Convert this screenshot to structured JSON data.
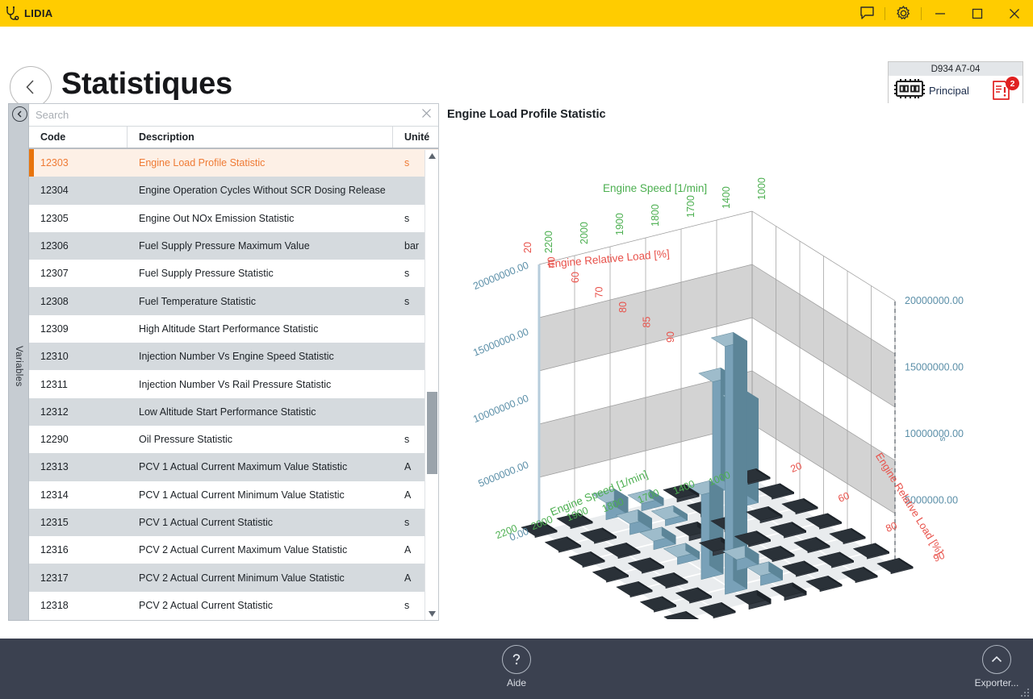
{
  "titlebar": {
    "app_name": "LIDIA",
    "logo_icon": "stethoscope-icon",
    "chat_icon": "chat-bubble-icon",
    "settings_icon": "gear-icon",
    "minimize_icon": "minimize-icon",
    "maximize_icon": "maximize-icon",
    "close_icon": "close-icon",
    "background": "#FFCC00"
  },
  "header": {
    "back_icon": "chevron-left-icon",
    "title": "Statistiques",
    "device": {
      "model": "D934 A7-04",
      "name": "Principal",
      "ecu_icon": "ecu-chip-icon",
      "warning_icon": "warning-document-icon",
      "warning_count": "2",
      "warning_color": "#e02020"
    }
  },
  "sidebar": {
    "tab_label": "Variables",
    "collapse_icon": "chevron-left-circle-icon"
  },
  "search": {
    "placeholder": "Search",
    "value": "",
    "clear_icon": "close-icon"
  },
  "table": {
    "columns": [
      "Code",
      "Description",
      "Unité"
    ],
    "selected_code": "12303",
    "selection_color": "#e8740c",
    "rows": [
      {
        "code": "12303",
        "description": "Engine Load Profile Statistic",
        "unit": "s"
      },
      {
        "code": "12304",
        "description": "Engine Operation Cycles Without SCR Dosing Release",
        "unit": ""
      },
      {
        "code": "12305",
        "description": "Engine Out NOx Emission Statistic",
        "unit": "s"
      },
      {
        "code": "12306",
        "description": "Fuel Supply Pressure Maximum Value",
        "unit": "bar"
      },
      {
        "code": "12307",
        "description": "Fuel Supply Pressure Statistic",
        "unit": "s"
      },
      {
        "code": "12308",
        "description": "Fuel Temperature Statistic",
        "unit": "s"
      },
      {
        "code": "12309",
        "description": "High Altitude Start Performance Statistic",
        "unit": ""
      },
      {
        "code": "12310",
        "description": "Injection Number Vs Engine Speed Statistic",
        "unit": ""
      },
      {
        "code": "12311",
        "description": "Injection Number Vs Rail Pressure Statistic",
        "unit": ""
      },
      {
        "code": "12312",
        "description": "Low Altitude Start Performance Statistic",
        "unit": ""
      },
      {
        "code": "12290",
        "description": "Oil Pressure Statistic",
        "unit": "s"
      },
      {
        "code": "12313",
        "description": "PCV 1 Actual Current Maximum Value Statistic",
        "unit": "A"
      },
      {
        "code": "12314",
        "description": "PCV 1 Actual Current Minimum Value Statistic",
        "unit": "A"
      },
      {
        "code": "12315",
        "description": "PCV 1 Actual Current Statistic",
        "unit": "s"
      },
      {
        "code": "12316",
        "description": "PCV 2 Actual Current Maximum Value Statistic",
        "unit": "A"
      },
      {
        "code": "12317",
        "description": "PCV 2 Actual Current Minimum Value Statistic",
        "unit": "A"
      },
      {
        "code": "12318",
        "description": "PCV 2 Actual Current Statistic",
        "unit": "s"
      }
    ],
    "scroll_up_icon": "triangle-up-icon",
    "scroll_down_icon": "triangle-down-icon"
  },
  "chart_panel": {
    "title": "Engine Load Profile Statistic"
  },
  "chart_data": {
    "type": "bar",
    "title": "Engine Load Profile Statistic",
    "render": "3d-bar",
    "xlabel": "Engine Speed [1/min]",
    "ylabel": "Engine Relative Load [%]",
    "zlabel": "s",
    "x_categories": [
      "2200",
      "2000",
      "1900",
      "1800",
      "1700",
      "1400",
      "1000"
    ],
    "y_categories": [
      "20",
      "40",
      "60",
      "70",
      "80",
      "85",
      "90"
    ],
    "y_ticks_right": [
      "20",
      "60",
      "80",
      "90"
    ],
    "z_ticks": [
      "0.00",
      "5000000.00",
      "10000000.00",
      "15000000.00",
      "20000000.00"
    ],
    "zlim": [
      0,
      22000000
    ],
    "axis_colors": {
      "x": "#4caf50",
      "y": "#e8514a",
      "z": "#5b8fa8",
      "bar": "#6a93a8"
    },
    "grid": true,
    "series": [
      {
        "name": "20",
        "values": [
          0,
          0,
          1400000,
          600000,
          300000,
          9200000,
          0
        ]
      },
      {
        "name": "40",
        "values": [
          0,
          0,
          900000,
          500000,
          250000,
          8600000,
          0
        ]
      },
      {
        "name": "60",
        "values": [
          0,
          0,
          700000,
          400000,
          200000,
          200000,
          0
        ]
      },
      {
        "name": "70",
        "values": [
          0,
          0,
          600000,
          350000,
          150000,
          150000,
          0
        ]
      },
      {
        "name": "80",
        "values": [
          0,
          0,
          7000000,
          900000,
          120000,
          120000,
          0
        ]
      },
      {
        "name": "85",
        "values": [
          0,
          0,
          20500000,
          800000,
          100000,
          100000,
          0
        ]
      },
      {
        "name": "90",
        "values": [
          0,
          0,
          400000,
          300000,
          80000,
          80000,
          0
        ]
      }
    ]
  },
  "bottombar": {
    "help": {
      "label": "Aide",
      "icon": "question-mark-icon"
    },
    "export": {
      "label": "Exporter...",
      "icon": "chevron-up-icon"
    },
    "background": "#3b4150"
  }
}
